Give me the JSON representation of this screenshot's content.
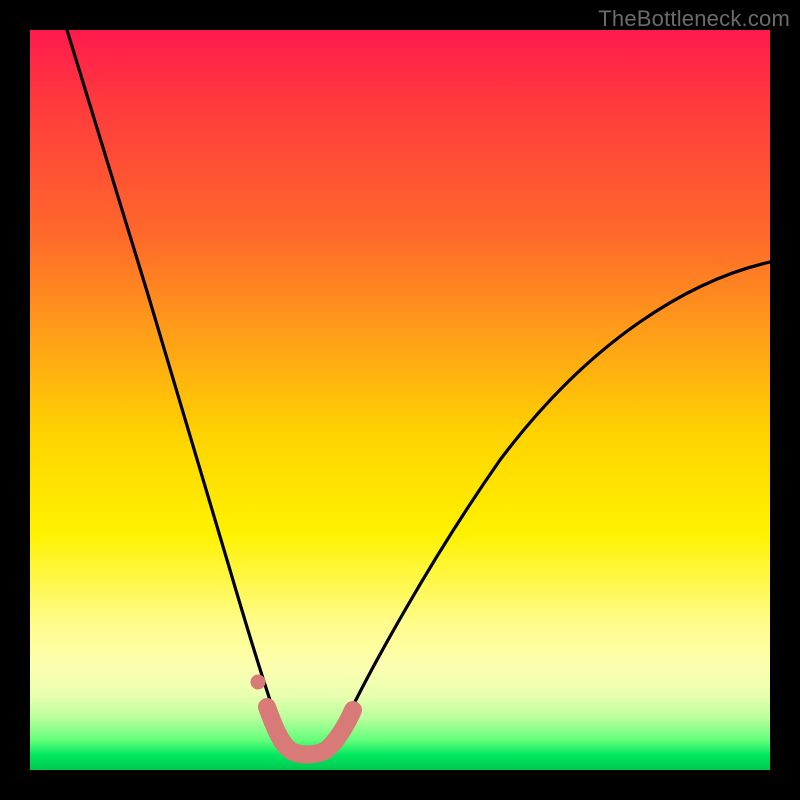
{
  "watermark": {
    "text": "TheBottleneck.com"
  },
  "colors": {
    "background": "#000000",
    "curve_stroke": "#000000",
    "marker_fill": "#d77a78",
    "marker_stroke": "#c96a68"
  },
  "chart_data": {
    "type": "line",
    "title": "",
    "xlabel": "",
    "ylabel": "",
    "xlim": [
      0,
      100
    ],
    "ylim": [
      0,
      100
    ],
    "grid": false,
    "legend": false,
    "note": "Bottleneck-style V-curve. Values are percentage of plot height from the bottom (0 = bottom edge, 100 = top edge), read off the gradient. Minimum sits near x≈34–40 at ~3%.",
    "series": [
      {
        "name": "bottleneck_curve",
        "x": [
          5,
          10,
          15,
          20,
          25,
          28,
          30,
          32,
          34,
          36,
          38,
          40,
          42,
          45,
          50,
          55,
          60,
          65,
          70,
          75,
          80,
          85,
          90,
          95,
          100
        ],
        "values": [
          100,
          88,
          73,
          56,
          36,
          22,
          14,
          8,
          4,
          3,
          3,
          3.5,
          5,
          9,
          17,
          25,
          32,
          38,
          44,
          49,
          54,
          58,
          62,
          65,
          68
        ]
      }
    ],
    "markers": {
      "name": "highlighted_band",
      "note": "Salmon rounded segment near the trough plus one small dot just above the left side of the trough.",
      "dot": {
        "x": 30.5,
        "y": 8
      },
      "band": {
        "x_start": 32,
        "x_end": 42.5,
        "y_approx": 3.5
      }
    }
  }
}
